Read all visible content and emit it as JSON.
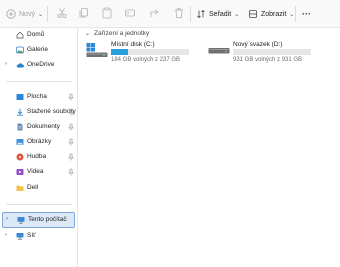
{
  "toolbar": {
    "new_label": "Nový",
    "sort_label": "Seřadit",
    "view_label": "Zobrazit",
    "more_label": "···"
  },
  "sidebar": {
    "top_items": [
      {
        "label": "Domů",
        "icon": "home-icon"
      },
      {
        "label": "Galerie",
        "icon": "gallery-icon"
      },
      {
        "label": "OneDrive",
        "icon": "cloud-icon"
      }
    ],
    "quick_access": [
      {
        "label": "Plocha",
        "icon": "desktop-icon",
        "pinned": true
      },
      {
        "label": "Stažené soubory",
        "icon": "download-icon",
        "pinned": true
      },
      {
        "label": "Dokumenty",
        "icon": "documents-icon",
        "pinned": true
      },
      {
        "label": "Obrázky",
        "icon": "pictures-icon",
        "pinned": true
      },
      {
        "label": "Hudba",
        "icon": "music-icon",
        "pinned": true
      },
      {
        "label": "Videa",
        "icon": "videos-icon",
        "pinned": true
      },
      {
        "label": "Dell",
        "icon": "folder-icon",
        "pinned": false
      }
    ],
    "bottom_items": [
      {
        "label": "Tento počítač",
        "icon": "computer-icon",
        "selected": true
      },
      {
        "label": "Síť",
        "icon": "network-icon",
        "selected": false
      }
    ]
  },
  "main": {
    "section_title": "Zařízení a jednotky",
    "drives": [
      {
        "name": "Místní disk (C:)",
        "free_text": "184 GB volných z 237 GB",
        "used_fraction": 0.22,
        "icon": "windows-drive-icon"
      },
      {
        "name": "Nový svazek (D:)",
        "free_text": "931 GB volných z 931 GB",
        "used_fraction": 0.0,
        "icon": "drive-icon"
      }
    ]
  },
  "colors": {
    "accent": "#26a0da",
    "selection_bg": "#dbe8f8",
    "selection_border": "#7fa7d9"
  }
}
